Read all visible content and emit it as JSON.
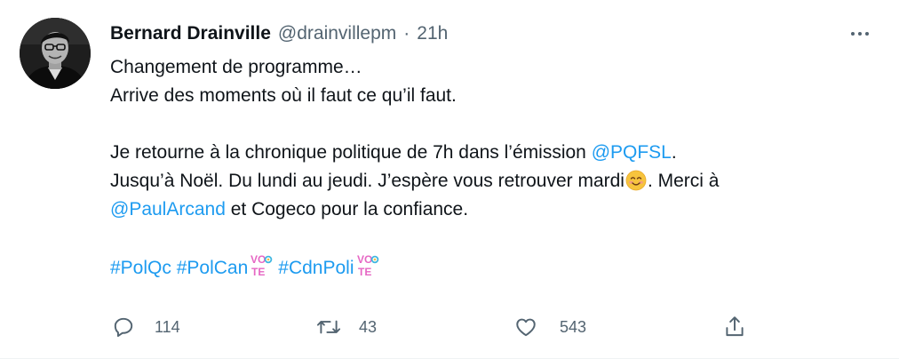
{
  "tweet": {
    "author": {
      "display_name": "Bernard Drainville",
      "handle": "@drainvillepm",
      "separator": "·",
      "time": "21h"
    },
    "body": {
      "line1": "Changement de programme…",
      "line2": "Arrive des moments où il faut ce qu’il faut.",
      "line3_before": "Je retourne à la chronique politique de 7h dans l’émission ",
      "line3_mention": "@PQFSL",
      "line3_after": ".",
      "line4_before": "Jusqu’à Noël. Du lundi au jeudi. J’espère vous retrouver mardi",
      "line4_after": ". Merci à",
      "line5_mention": "@PaulArcand",
      "line5_after": " et Cogeco pour la confiance.",
      "hashtags": [
        "#PolQc",
        "#PolCan",
        "#CdnPoli"
      ],
      "vote_badge": {
        "top": "VO",
        "bottom": "TE"
      }
    },
    "actions": {
      "reply_count": "114",
      "retweet_count": "43",
      "like_count": "543"
    },
    "icons": {
      "avatar": "avatar-photo",
      "more": "more-dots-icon",
      "emoji": "smiling-face-emoji",
      "reply": "reply-icon",
      "retweet": "retweet-icon",
      "like": "heart-icon",
      "share": "share-icon"
    },
    "colors": {
      "link": "#1d9bf0",
      "secondary_text": "#536471",
      "primary_text": "#0f1419",
      "vote_pink": "#e667c4",
      "vote_blue": "#3fb6e0",
      "vote_yellow": "#f5c342"
    }
  }
}
